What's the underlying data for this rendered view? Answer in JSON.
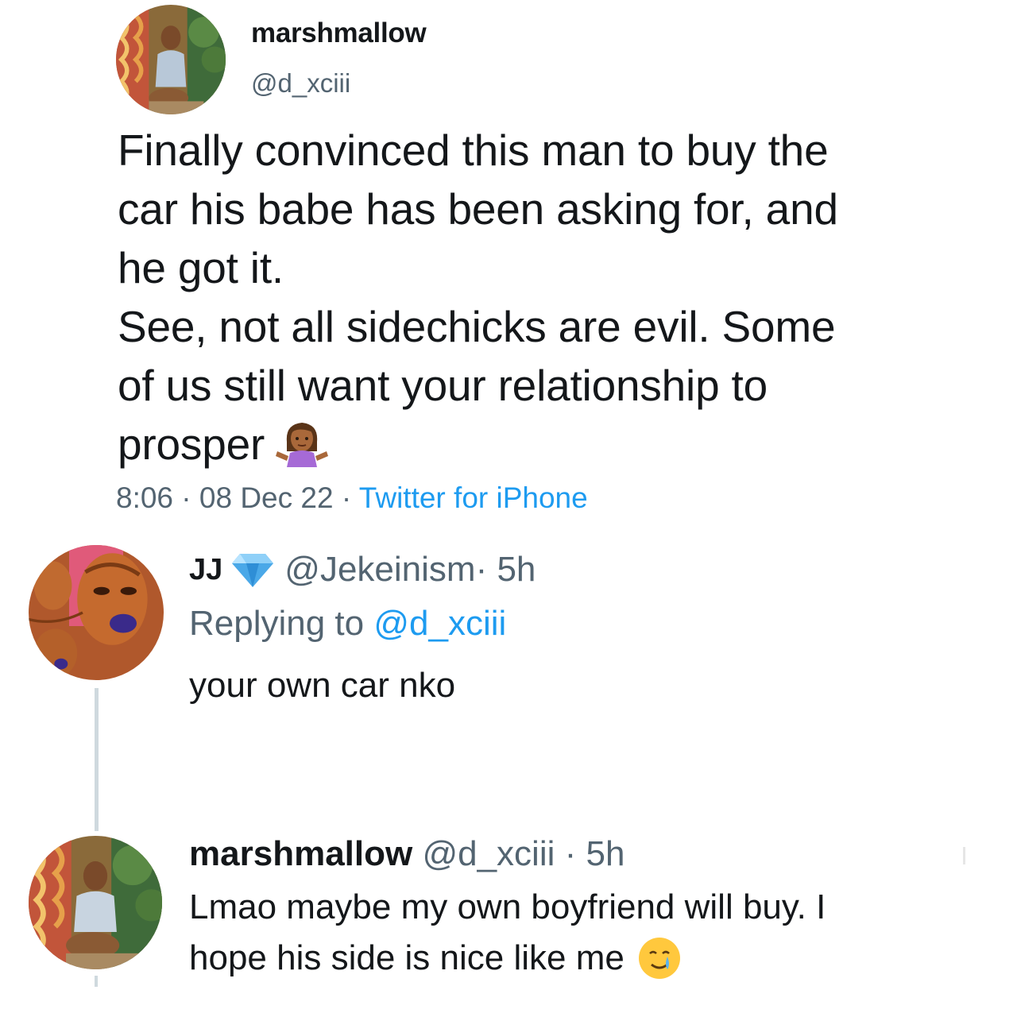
{
  "main_tweet": {
    "display_name": "marshmallow",
    "handle": "@d_xciii",
    "text_lines": [
      "Finally convinced this man to buy the",
      "car his babe has been asking for, and",
      "he got it.",
      "See, not all sidechicks are evil. Some",
      "of us still want your relationship to",
      "prosper"
    ],
    "emoji": "person-shrugging-emoji",
    "time": "8:06",
    "separator": " · ",
    "date": "08 Dec 22",
    "source": "Twitter for iPhone"
  },
  "reply_1": {
    "display_name": "JJ",
    "verified_icon": "blue-diamond-icon",
    "handle": "@Jekeinism",
    "age": " · 5h",
    "replying_prefix": "Replying to ",
    "replying_to": "@d_xciii",
    "text": "your own car nko"
  },
  "reply_2": {
    "display_name": "marshmallow",
    "handle": " @d_xciii",
    "age": " · 5h",
    "text_lines": [
      "Lmao maybe my own boyfriend will buy. I",
      "hope his side is nice like me"
    ],
    "emoji": "smiling-face-with-tear-emoji"
  },
  "colors": {
    "text_primary": "#14171a",
    "text_secondary": "#536471",
    "link": "#1d9bf0",
    "thread_line": "#cfd9de"
  }
}
